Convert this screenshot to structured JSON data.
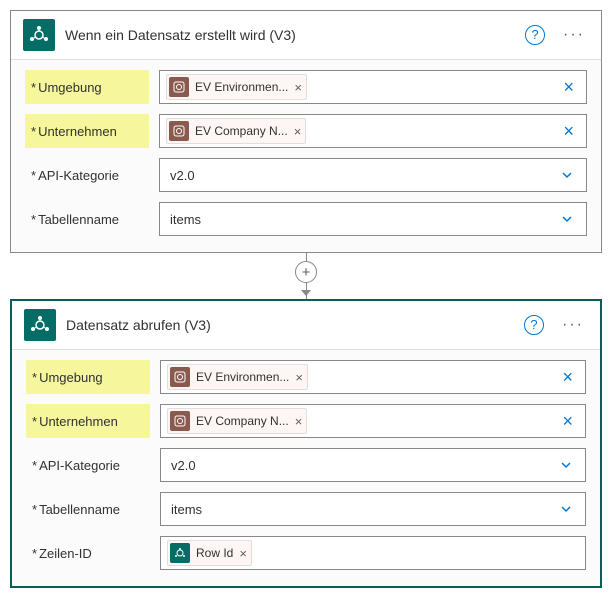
{
  "card1": {
    "title": "Wenn ein Datensatz erstellt wird (V3)",
    "rows": {
      "umgebung_label": "Umgebung",
      "umgebung_token": "EV Environmen...",
      "unternehmen_label": "Unternehmen",
      "unternehmen_token": "EV Company N...",
      "api_label": "API-Kategorie",
      "api_value": "v2.0",
      "tabelle_label": "Tabellenname",
      "tabelle_value": "items"
    }
  },
  "card2": {
    "title": "Datensatz abrufen (V3)",
    "rows": {
      "umgebung_label": "Umgebung",
      "umgebung_token": "EV Environmen...",
      "unternehmen_label": "Unternehmen",
      "unternehmen_token": "EV Company N...",
      "api_label": "API-Kategorie",
      "api_value": "v2.0",
      "tabelle_label": "Tabellenname",
      "tabelle_value": "items",
      "zeilen_label": "Zeilen-ID",
      "zeilen_token": "Row Id"
    }
  }
}
